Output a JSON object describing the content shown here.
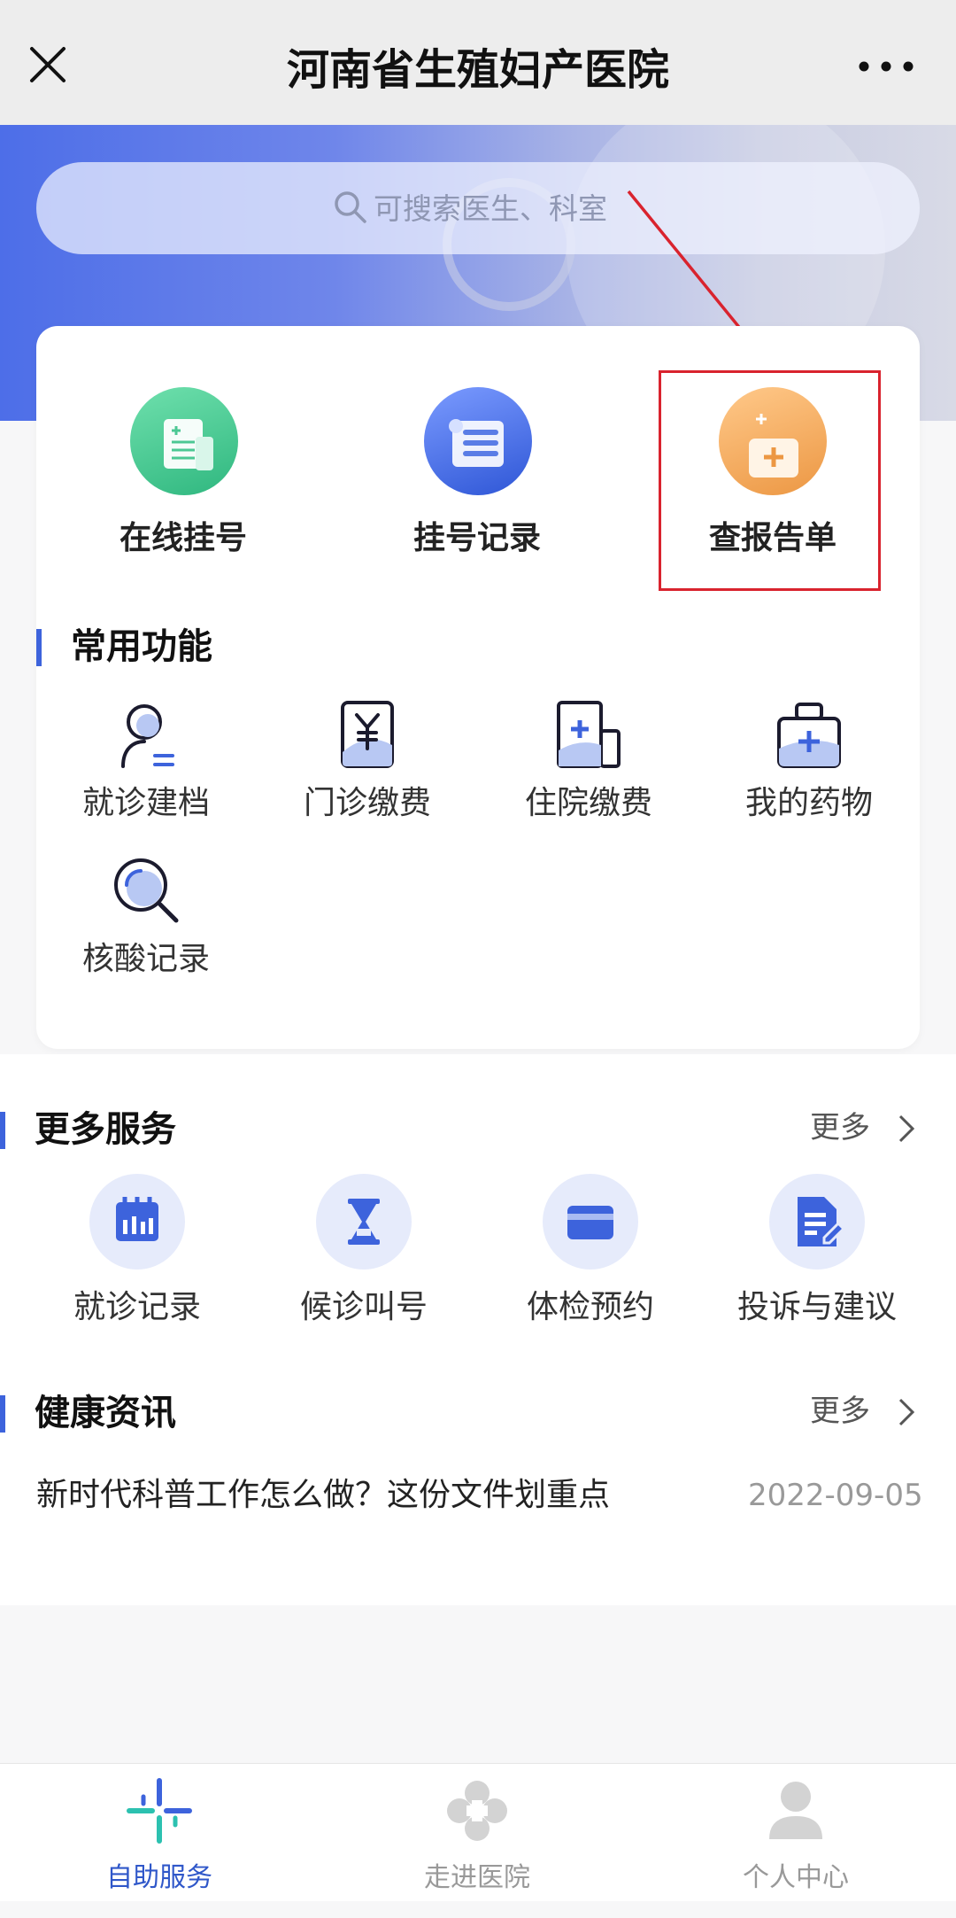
{
  "header": {
    "title": "河南省生殖妇产医院"
  },
  "search": {
    "placeholder": "可搜索医生、科室"
  },
  "quick_actions": [
    {
      "label": "在线挂号",
      "icon": "register-doc-icon",
      "color": "#3cc48f"
    },
    {
      "label": "挂号记录",
      "icon": "scroll-record-icon",
      "color": "#3d63dc"
    },
    {
      "label": "查报告单",
      "icon": "report-kit-icon",
      "color": "#f0a04b",
      "highlighted": true
    }
  ],
  "common": {
    "title": "常用功能",
    "items": [
      {
        "label": "就诊建档",
        "icon": "user-profile-icon"
      },
      {
        "label": "门诊缴费",
        "icon": "yuan-payment-icon"
      },
      {
        "label": "住院缴费",
        "icon": "hospital-building-icon"
      },
      {
        "label": "我的药物",
        "icon": "medicine-kit-icon"
      },
      {
        "label": "核酸记录",
        "icon": "magnifier-icon"
      }
    ]
  },
  "more_services": {
    "title": "更多服务",
    "more": "更多",
    "items": [
      {
        "label": "就诊记录",
        "icon": "calendar-icon"
      },
      {
        "label": "候诊叫号",
        "icon": "hourglass-icon"
      },
      {
        "label": "体检预约",
        "icon": "card-icon"
      },
      {
        "label": "投诉与建议",
        "icon": "edit-document-icon"
      }
    ]
  },
  "health_news": {
    "title": "健康资讯",
    "more": "更多",
    "items": [
      {
        "title": "新时代科普工作怎么做？这份文件划重点",
        "date": "2022-09-05"
      }
    ]
  },
  "tabbar": {
    "active_color": "#2f57c9",
    "items": [
      {
        "label": "自助服务",
        "icon": "self-service-icon",
        "active": true
      },
      {
        "label": "走进医院",
        "icon": "hospital-flower-icon",
        "active": false
      },
      {
        "label": "个人中心",
        "icon": "person-icon",
        "active": false
      }
    ]
  }
}
